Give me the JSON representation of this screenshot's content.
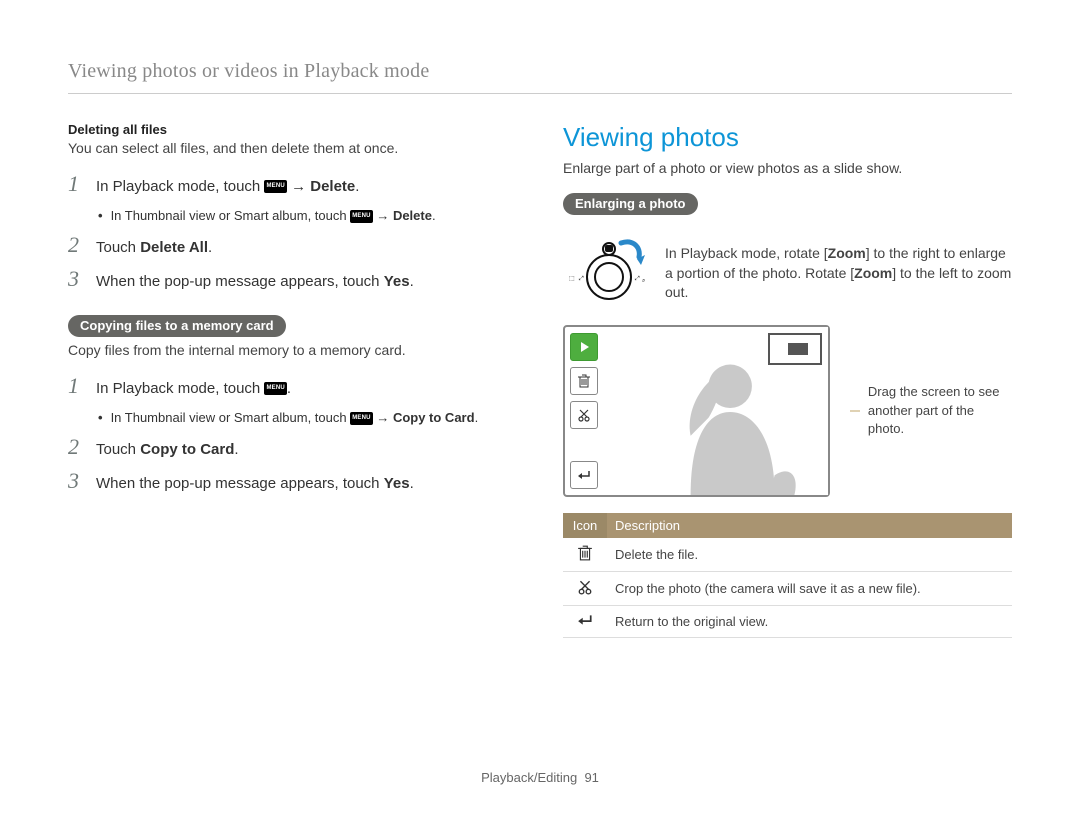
{
  "header": {
    "title": "Viewing photos or videos in Playback mode"
  },
  "left": {
    "deletingAll": {
      "heading": "Deleting all files",
      "desc": "You can select all files, and then delete them at once.",
      "steps": [
        {
          "n": "1",
          "pre": "In Playback mode, touch ",
          "icon": "MENU",
          "post": " → ",
          "bold": "Delete",
          "tail": "."
        },
        {
          "sub": true,
          "pre": "In Thumbnail view or Smart album, touch ",
          "icon": "MENU",
          "post": " → ",
          "bold": "Delete",
          "tail": "."
        },
        {
          "n": "2",
          "pre": "Touch ",
          "bold": "Delete All",
          "tail": "."
        },
        {
          "n": "3",
          "pre": "When the pop-up message appears, touch ",
          "bold": "Yes",
          "tail": "."
        }
      ]
    },
    "copying": {
      "pill": "Copying files to a memory card",
      "desc": "Copy files from the internal memory to a memory card.",
      "steps": [
        {
          "n": "1",
          "pre": "In Playback mode, touch ",
          "icon": "MENU",
          "tail": "."
        },
        {
          "sub": true,
          "pre": "In Thumbnail view or Smart album, touch ",
          "icon": "MENU",
          "post": " → ",
          "bold": "Copy to Card",
          "tail": "."
        },
        {
          "n": "2",
          "pre": "Touch ",
          "bold": "Copy to Card",
          "tail": "."
        },
        {
          "n": "3",
          "pre": "When the pop-up message appears, touch ",
          "bold": "Yes",
          "tail": "."
        }
      ]
    }
  },
  "right": {
    "title": "Viewing photos",
    "desc": "Enlarge part of a photo or view photos as a slide show.",
    "enlarging": {
      "pill": "Enlarging a photo",
      "zoom_pre": "In Playback mode, rotate [",
      "zoom_bold1": "Zoom",
      "zoom_mid": "] to the right to enlarge a portion of the photo. Rotate [",
      "zoom_bold2": "Zoom",
      "zoom_post": "] to the left to zoom out."
    },
    "lcd_note": "Drag the screen to see another part of the photo.",
    "icon_table": {
      "headers": {
        "icon": "Icon",
        "desc": "Description"
      },
      "rows": [
        {
          "icon": "trash-icon",
          "desc": "Delete the file."
        },
        {
          "icon": "scissors-icon",
          "desc": "Crop the photo (the camera will save it as a new file)."
        },
        {
          "icon": "return-icon",
          "desc": "Return to the original view."
        }
      ]
    }
  },
  "footer": {
    "section": "Playback/Editing",
    "page": "91"
  }
}
